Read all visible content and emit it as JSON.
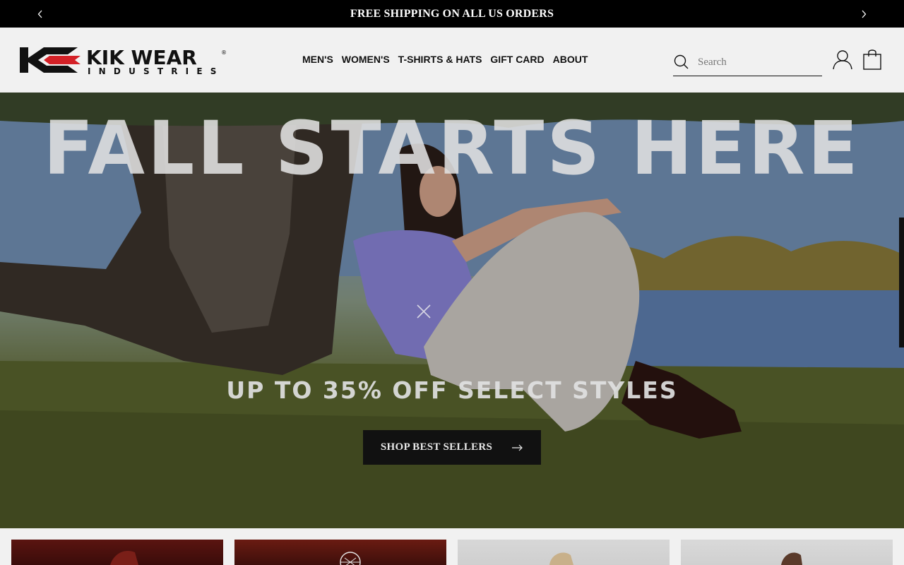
{
  "announcement": {
    "text": "FREE SHIPPING ON ALL US ORDERS",
    "prev_icon": "chevron-left-icon",
    "next_icon": "chevron-right-icon"
  },
  "header": {
    "logo": {
      "brand": "KIK WEAR",
      "sub": "INDUSTRIES",
      "mark": "®"
    },
    "nav": [
      {
        "label": "MEN'S"
      },
      {
        "label": "WOMEN'S"
      },
      {
        "label": "T-SHIRTS & HATS"
      },
      {
        "label": "GIFT CARD"
      },
      {
        "label": "ABOUT"
      }
    ],
    "search": {
      "placeholder": "Search"
    }
  },
  "hero": {
    "headline": "FALL STARTS HERE",
    "subline": "UP TO 35% OFF SELECT STYLES",
    "cta_label": "SHOP BEST SELLERS",
    "colors": {
      "cta_bg": "#111111",
      "headline": "#e1e1e1"
    }
  },
  "colors": {
    "announcement_bg": "#000000",
    "header_bg": "#f1f1f1",
    "brand_red": "#d42127"
  }
}
